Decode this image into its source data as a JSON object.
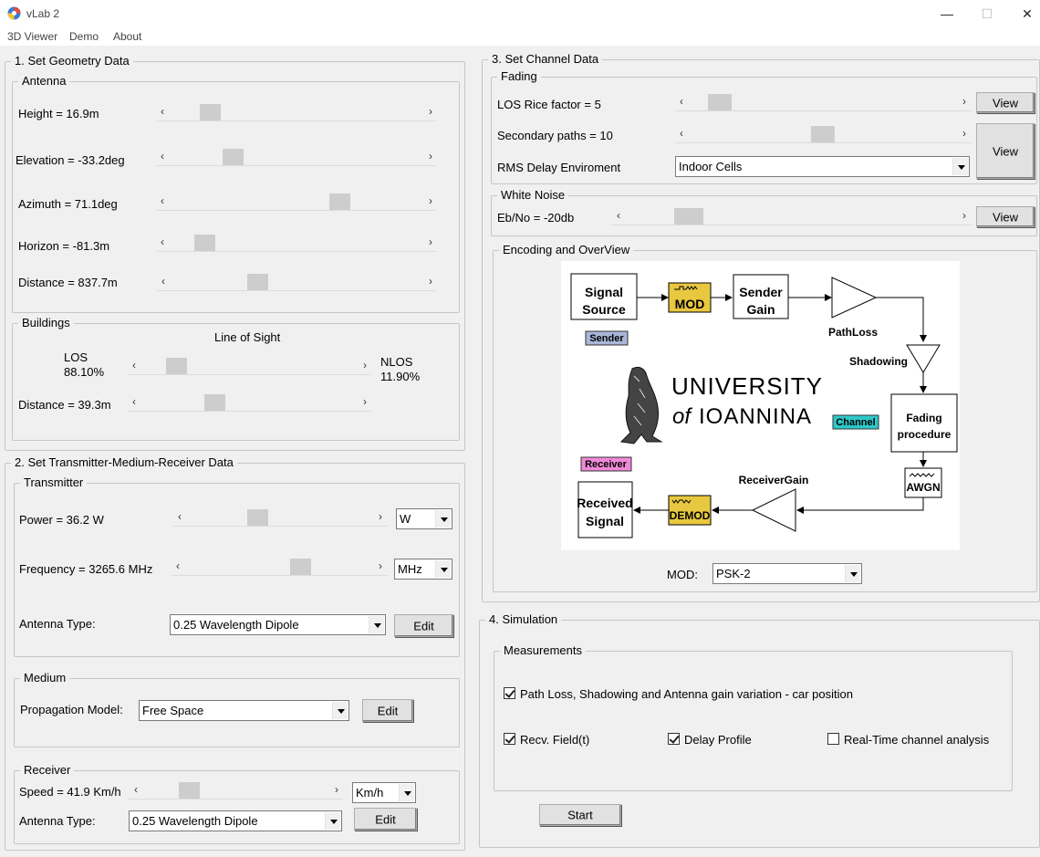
{
  "window": {
    "title": "vLab 2"
  },
  "menu": [
    "3D Viewer",
    "Demo",
    "About"
  ],
  "geometry": {
    "legend": "1. Set Geometry Data",
    "antenna": {
      "legend": "Antenna",
      "height": "Height = 16.9m",
      "elevation": "Elevation = -33.2deg",
      "azimuth": "Azimuth = 71.1deg",
      "horizon": "Horizon = -81.3m",
      "distance": "Distance = 837.7m"
    },
    "buildings": {
      "legend": "Buildings",
      "line_of_sight": "Line of Sight",
      "los_label": "LOS",
      "los_value": "88.10%",
      "nlos_label": "NLOS",
      "nlos_value": "11.90%",
      "distance": "Distance = 39.3m"
    }
  },
  "tmr": {
    "legend": "2. Set Transmitter-Medium-Receiver Data",
    "transmitter": {
      "legend": "Transmitter",
      "power": "Power = 36.2 W",
      "power_unit": "W",
      "frequency": "Frequency = 3265.6 MHz",
      "frequency_unit": "MHz",
      "antenna_type_label": "Antenna Type:",
      "antenna_type": "0.25 Wavelength Dipole",
      "edit": "Edit"
    },
    "medium": {
      "legend": "Medium",
      "model_label": "Propagation Model:",
      "model": "Free Space",
      "edit": "Edit"
    },
    "receiver": {
      "legend": "Receiver",
      "speed": "Speed = 41.9 Km/h",
      "speed_unit": "Km/h",
      "antenna_type_label": "Antenna Type:",
      "antenna_type": "0.25 Wavelength Dipole",
      "edit": "Edit"
    }
  },
  "channel": {
    "legend": "3. Set Channel Data",
    "fading": {
      "legend": "Fading",
      "los_rice": "LOS Rice factor = 5",
      "secondary": "Secondary paths = 10",
      "rms_label": "RMS Delay Enviroment",
      "rms_value": "Indoor Cells",
      "view": "View"
    },
    "noise": {
      "legend": "White Noise",
      "ebno": "Eb/No = -20db",
      "view": "View"
    },
    "encoding": {
      "legend": "Encoding and OverView",
      "mod_label": "MOD:",
      "mod_value": "PSK-2",
      "diagram": {
        "signal_source": [
          "Signal",
          "Source"
        ],
        "mod": "MOD",
        "sender_gain": [
          "Sender",
          "Gain"
        ],
        "pathloss": "PathLoss",
        "shadowing": "Shadowing",
        "sender_tag": "Sender",
        "channel_tag": "Channel",
        "receiver_tag": "Receiver",
        "fading": [
          "Fading",
          "procedure"
        ],
        "awgn": "AWGN",
        "receiver_gain": "ReceiverGain",
        "demod": "DEMOD",
        "received": [
          "Received",
          "Signal"
        ],
        "univ_line1": "UNIVERSITY",
        "univ_of": "of",
        "univ_line2": "IOANNINA"
      }
    }
  },
  "simulation": {
    "legend": "4. Simulation",
    "measurements_legend": "Measurements",
    "path_loss": "Path Loss, Shadowing and Antenna gain variation - car position",
    "recv_field": "Recv. Field(t)",
    "delay_profile": "Delay Profile",
    "realtime": "Real-Time channel analysis",
    "start": "Start",
    "checks": {
      "path_loss": true,
      "recv_field": true,
      "delay_profile": true,
      "realtime": false
    }
  },
  "colors": {
    "mod_fill": "#e8c840",
    "sender_tag": "#a9b6d8",
    "channel_tag": "#2ec8c8",
    "receiver_tag": "#f08ad8"
  }
}
